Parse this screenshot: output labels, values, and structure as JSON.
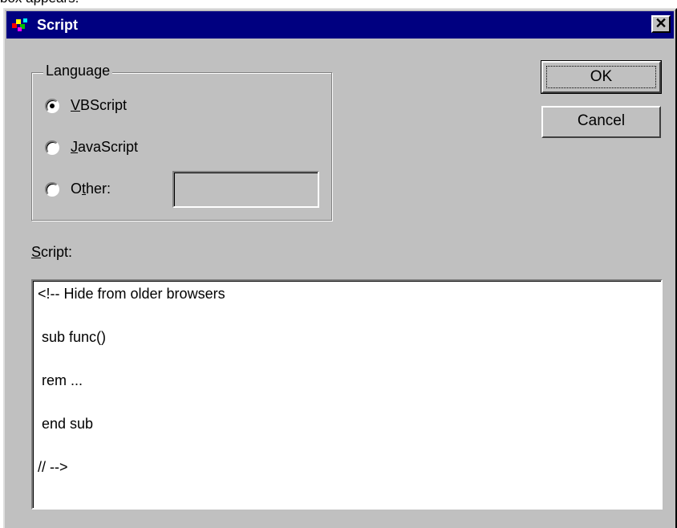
{
  "caption_fragment": "box appears.",
  "window": {
    "title": "Script",
    "close_glyph": "✕"
  },
  "language_group": {
    "legend": "Language",
    "options": [
      {
        "pre": "",
        "mnemonic": "V",
        "post": "BScript",
        "selected": true
      },
      {
        "pre": "",
        "mnemonic": "J",
        "post": "avaScript",
        "selected": false
      },
      {
        "pre": "O",
        "mnemonic": "t",
        "post": "her:",
        "selected": false
      }
    ],
    "other_value": ""
  },
  "buttons": {
    "ok": "OK",
    "cancel": "Cancel"
  },
  "script": {
    "label_mnemonic": "S",
    "label_rest": "cript:",
    "lines": [
      "<!-- Hide from older browsers",
      " sub func()",
      " rem ...",
      " end sub",
      "// -->"
    ]
  },
  "colors": {
    "titlebar": "#000080",
    "face": "#c0c0c0"
  }
}
